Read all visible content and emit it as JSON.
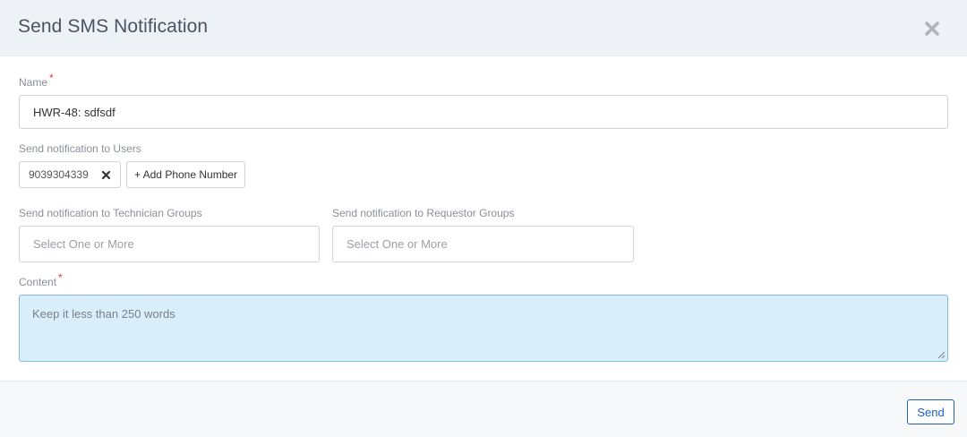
{
  "modal": {
    "title": "Send SMS Notification",
    "close_icon": "close-icon"
  },
  "form": {
    "name_label": "Name",
    "name_required": "*",
    "name_value": "HWR-48: sdfsdf",
    "users_label": "Send notification to Users",
    "user_chip": "9039304339",
    "add_phone_label": "+ Add Phone Number",
    "tech_groups_label": "Send notification to Technician Groups",
    "tech_groups_placeholder": "Select One or More",
    "req_groups_label": "Send notification to Requestor Groups",
    "req_groups_placeholder": "Select One or More",
    "content_label": "Content",
    "content_required": "*",
    "content_placeholder": "Keep it less than 250 words"
  },
  "footer": {
    "send_label": "Send"
  },
  "colors": {
    "header_bg": "#eef2f6",
    "required": "#e53935",
    "accent": "#1f5fbf",
    "textarea_focus_bg": "#d9eefb"
  }
}
